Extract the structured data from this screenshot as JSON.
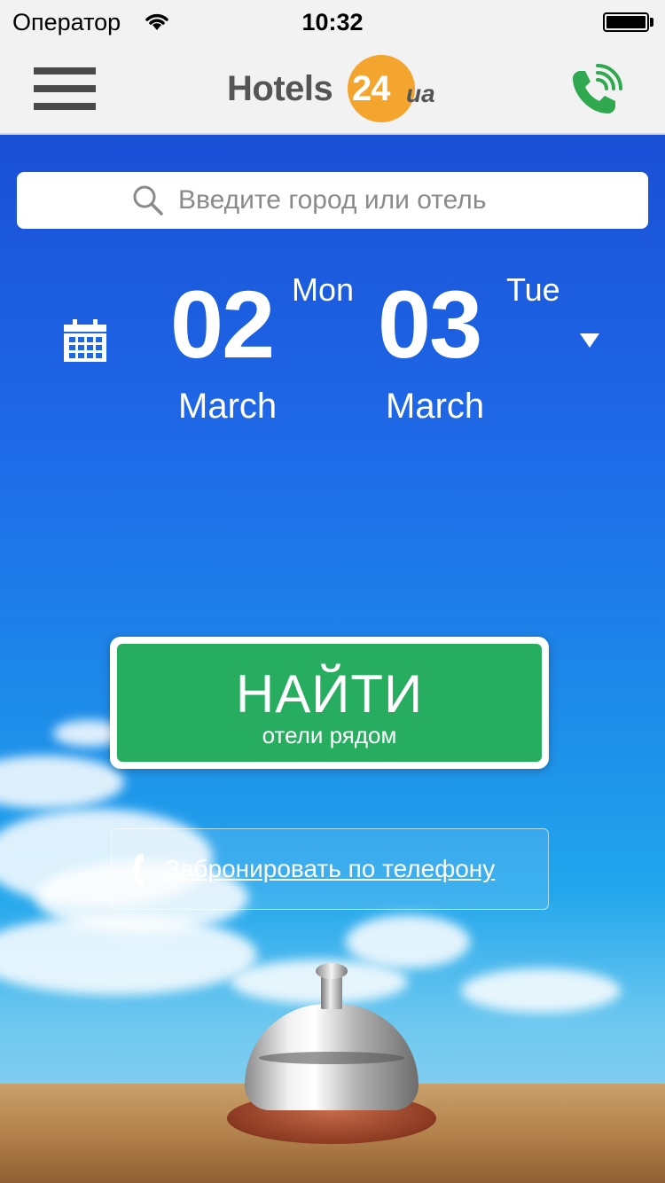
{
  "status_bar": {
    "carrier": "Оператор",
    "time": "10:32"
  },
  "header": {
    "logo": {
      "text": "Hotels",
      "number": "24",
      "suffix": "ua"
    },
    "menu_icon": "hamburger-menu-icon",
    "call_icon": "phone-call-icon"
  },
  "search": {
    "placeholder": "Введите город или отель",
    "icon": "search-icon"
  },
  "dates": {
    "calendar_icon": "calendar-icon",
    "check_in": {
      "day": "02",
      "weekday": "Mon",
      "month": "March"
    },
    "check_out": {
      "day": "03",
      "weekday": "Tue",
      "month": "March"
    }
  },
  "find_button": {
    "title": "НАЙТИ",
    "subtitle": "отели рядом",
    "color": "#27ad5f"
  },
  "phone_booking": {
    "label": "Забронировать по телефону",
    "icon": "phone-icon"
  },
  "colors": {
    "brand_orange": "#f3a52e",
    "call_green": "#2fa84f",
    "sky_blue": "#1e6ae8"
  }
}
